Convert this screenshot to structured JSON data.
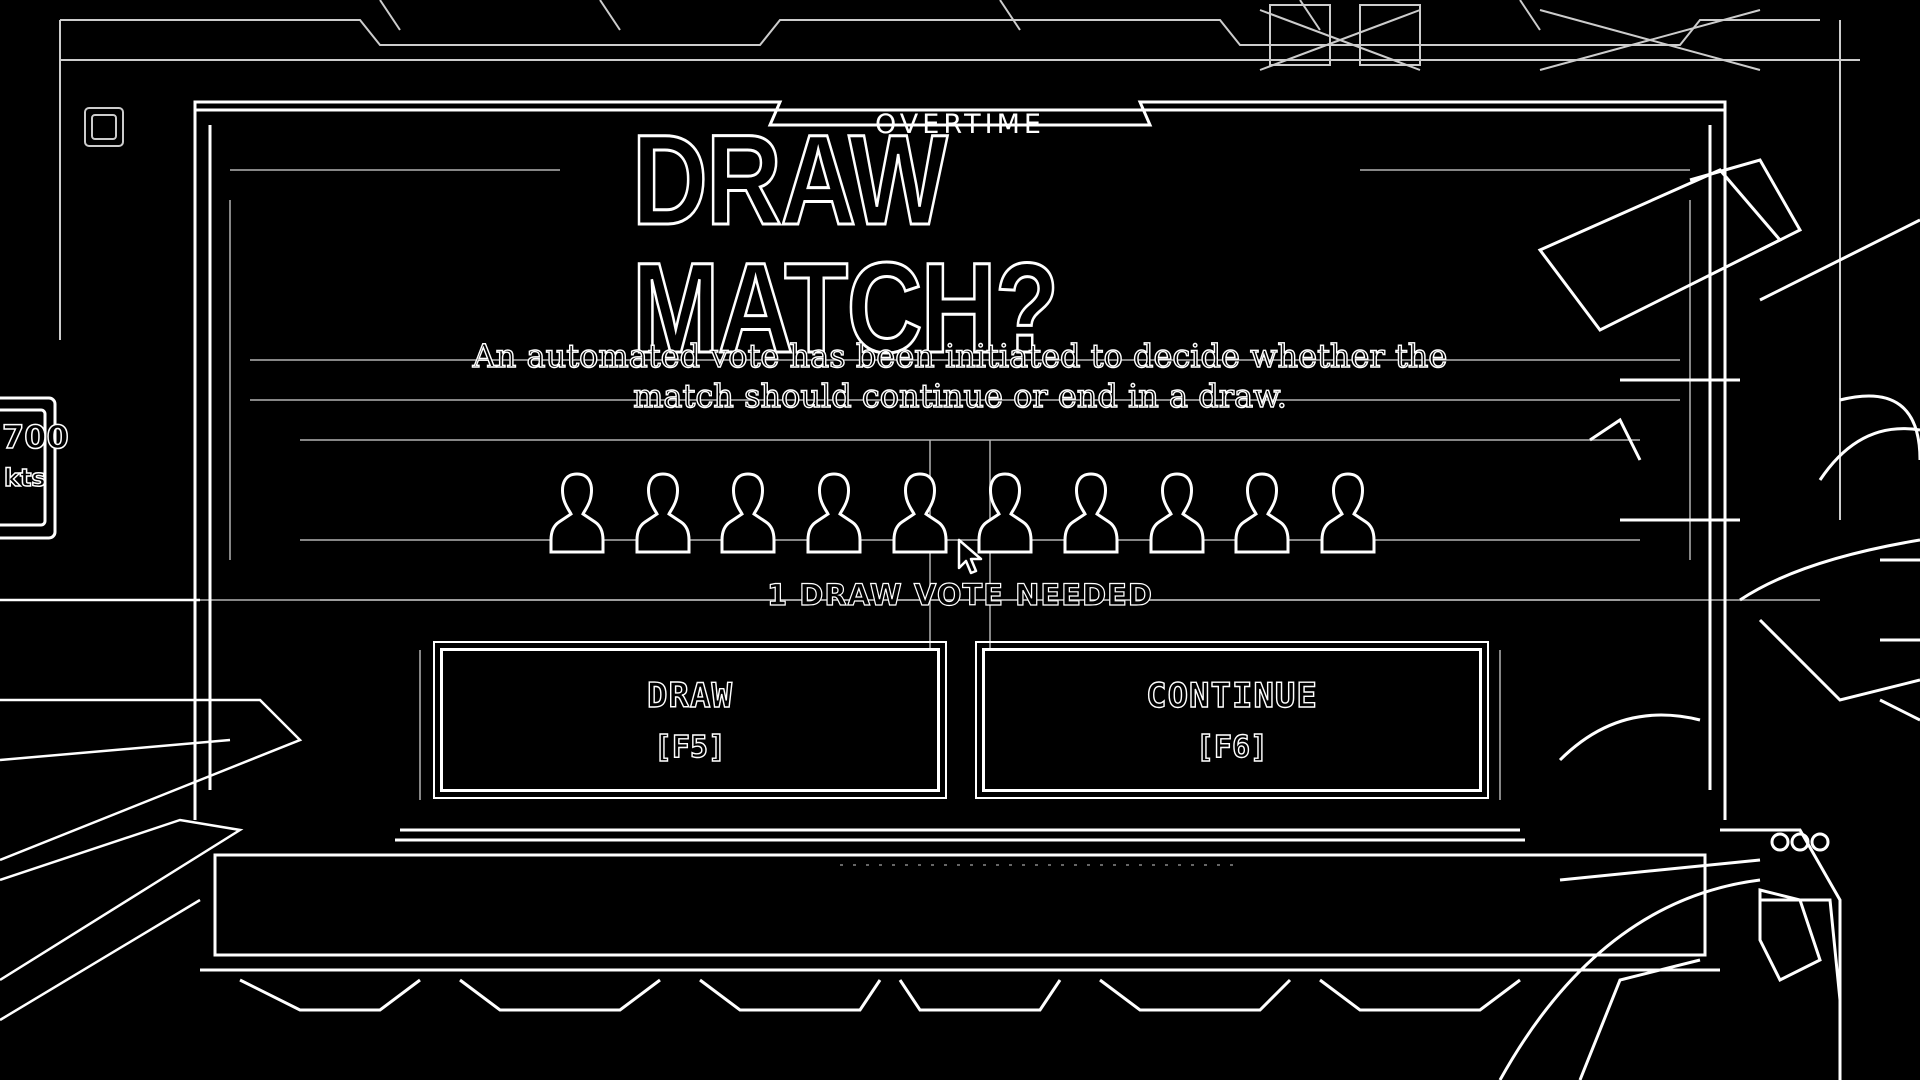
{
  "header": {
    "tab_label": "OVERTIME"
  },
  "dialog": {
    "title": "DRAW MATCH?",
    "description": "An automated vote has been initiated to decide whether the match should continue or end in a draw.",
    "voters": [
      {
        "icon": "player-silhouette-icon"
      },
      {
        "icon": "player-silhouette-icon"
      },
      {
        "icon": "player-silhouette-icon"
      },
      {
        "icon": "player-silhouette-icon"
      },
      {
        "icon": "player-silhouette-icon"
      },
      {
        "icon": "player-silhouette-icon"
      },
      {
        "icon": "player-silhouette-icon"
      },
      {
        "icon": "player-silhouette-icon"
      },
      {
        "icon": "player-silhouette-icon"
      },
      {
        "icon": "player-silhouette-icon"
      }
    ],
    "votes_needed_text": "1 DRAW VOTE NEEDED",
    "draw_button": {
      "label": "DRAW",
      "key": "[F5]"
    },
    "continue_button": {
      "label": "CONTINUE",
      "key": "[F6]"
    }
  },
  "hud": {
    "sign_text_1": "700",
    "sign_text_2": "kts"
  },
  "colors": {
    "foreground": "#ffffff",
    "background": "#000000"
  }
}
